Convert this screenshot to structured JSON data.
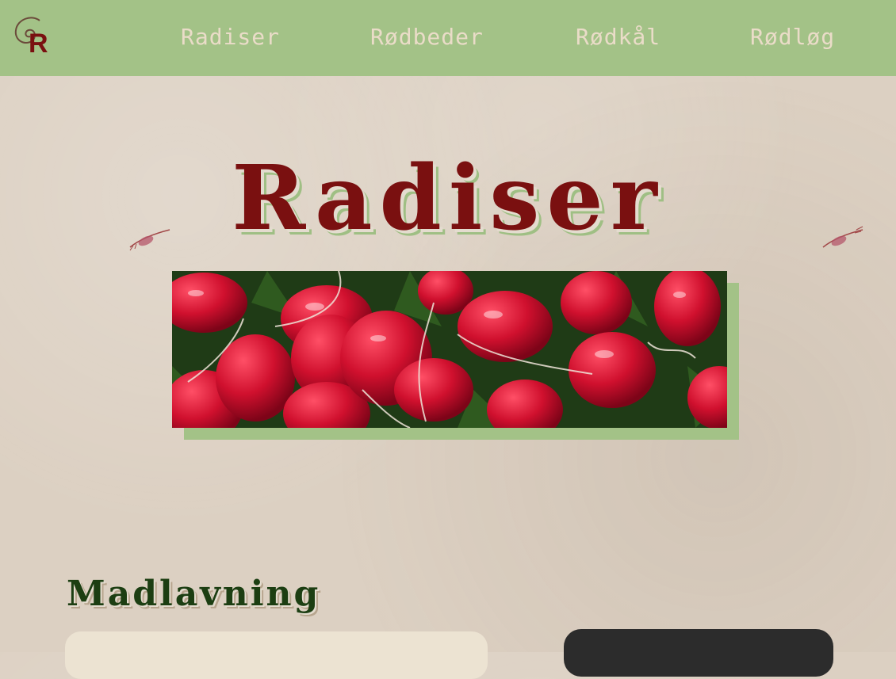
{
  "nav": {
    "logo_text": "R",
    "items": [
      {
        "label": "Radiser"
      },
      {
        "label": "Rødbeder"
      },
      {
        "label": "Rødkål"
      },
      {
        "label": "Rødløg"
      }
    ]
  },
  "hero": {
    "title": "Radiser"
  },
  "section": {
    "heading": "Madlavning"
  },
  "colors": {
    "nav_bg": "#a3c287",
    "title_red": "#7a1010",
    "heading_green": "#1c3e12",
    "paper": "#dcd0c2"
  }
}
